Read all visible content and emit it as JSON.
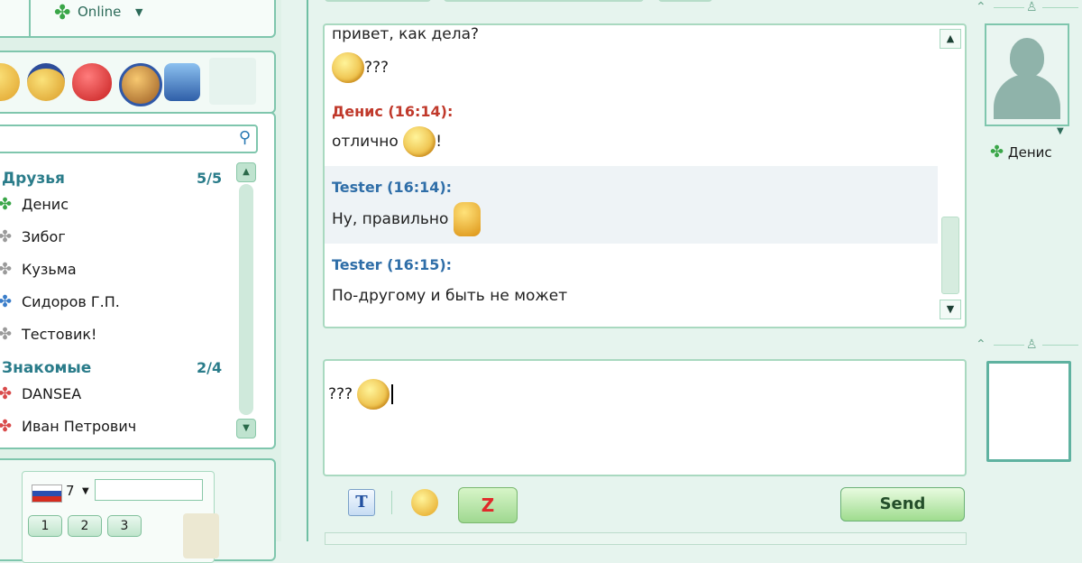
{
  "status": {
    "label": "Online",
    "icon": "clover-icon"
  },
  "emoticon_bar": {
    "items": [
      "smiley-icon",
      "prince-smiley-icon",
      "heart-icon",
      "lion-smiley-icon",
      "robot-smiley-icon"
    ]
  },
  "contacts": {
    "groups": [
      {
        "name": "Друзья",
        "count": "5/5",
        "members": [
          {
            "name": "Денис",
            "status": "online"
          },
          {
            "name": "Зибог",
            "status": "offline"
          },
          {
            "name": "Кузьма",
            "status": "offline"
          },
          {
            "name": "Сидоров Г.П.",
            "status": "multi"
          },
          {
            "name": "Тестовик!",
            "status": "offline"
          }
        ]
      },
      {
        "name": "Знакомые",
        "count": "2/4",
        "members": [
          {
            "name": "DANSEA",
            "status": "away"
          },
          {
            "name": "Иван Петрович",
            "status": "away"
          }
        ]
      }
    ]
  },
  "dialer": {
    "country_code": "7",
    "keys": [
      "1",
      "2",
      "3"
    ]
  },
  "chat": {
    "messages": [
      {
        "text": "привет, как дела?"
      },
      {
        "text": "???"
      },
      {
        "sender": "Денис (16:14):",
        "text": "отлично",
        "suffix": "!"
      },
      {
        "sender": "Tester (16:14):",
        "text": "Ну, правильно"
      },
      {
        "sender": "Tester (16:15):",
        "text": "По-другому и быть не может"
      }
    ],
    "input_value": "???"
  },
  "toolbar": {
    "font_label": "T",
    "nudge_label": "Z",
    "send_label": "Send"
  },
  "peer": {
    "name": "Денис"
  },
  "colors": {
    "accent": "#7fc6ad",
    "incoming_sender": "#c0392b",
    "outgoing_sender": "#2f6ea8",
    "online": "#3aa648"
  }
}
